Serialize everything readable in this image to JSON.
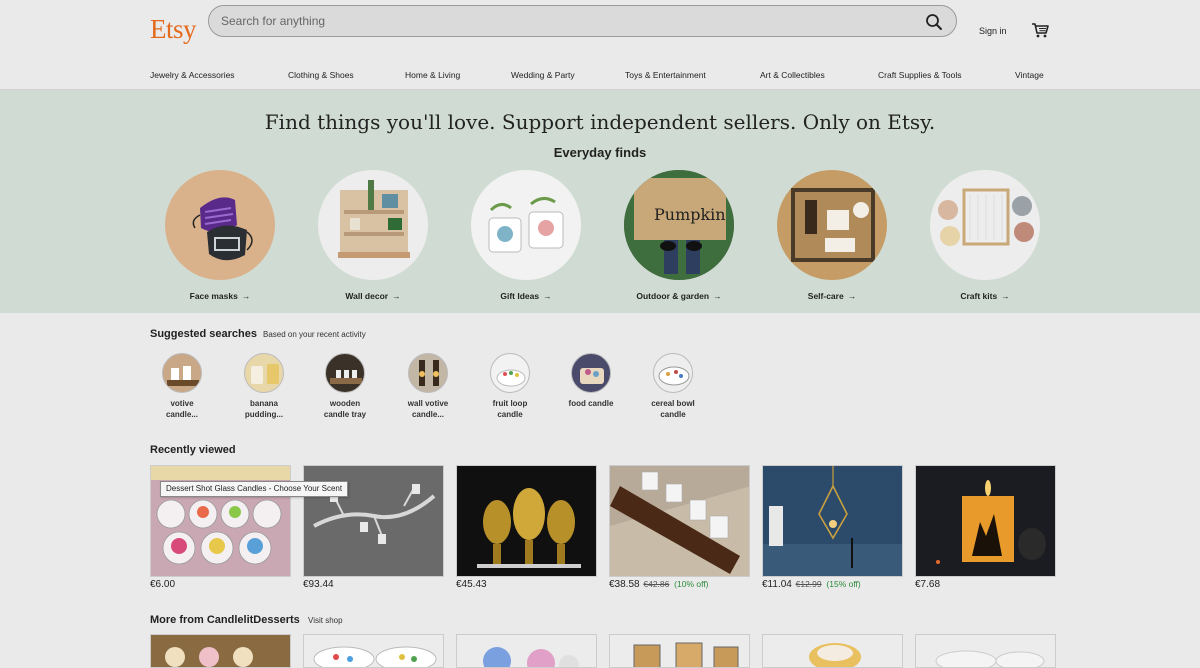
{
  "header": {
    "logo": "Etsy",
    "search_placeholder": "Search for anything",
    "sign_in": "Sign in"
  },
  "nav": [
    "Jewelry & Accessories",
    "Clothing & Shoes",
    "Home & Living",
    "Wedding & Party",
    "Toys & Entertainment",
    "Art & Collectibles",
    "Craft Supplies & Tools",
    "Vintage"
  ],
  "hero": {
    "title": "Find things you'll love. Support independent sellers. Only on Etsy.",
    "subtitle": "Everyday finds",
    "arrow": "→",
    "categories": [
      "Face masks",
      "Wall decor",
      "Gift Ideas",
      "Outdoor & garden",
      "Self-care",
      "Craft kits"
    ]
  },
  "suggested": {
    "title": "Suggested searches",
    "note": "Based on your recent activity",
    "items": [
      [
        "votive",
        "candle..."
      ],
      [
        "banana",
        "pudding..."
      ],
      [
        "wooden",
        "candle tray"
      ],
      [
        "wall votive",
        "candle..."
      ],
      [
        "fruit loop",
        "candle"
      ],
      [
        "food candle",
        ""
      ],
      [
        "cereal bowl",
        "candle"
      ]
    ]
  },
  "recent": {
    "title": "Recently viewed",
    "tooltip": "Dessert Shot Glass Candles - Choose Your Scent",
    "items": [
      {
        "price": "€6.00",
        "old": "",
        "disc": ""
      },
      {
        "price": "€93.44",
        "old": "",
        "disc": ""
      },
      {
        "price": "€45.43",
        "old": "",
        "disc": ""
      },
      {
        "price": "€38.58",
        "old": "€42.86",
        "disc": "(10% off)"
      },
      {
        "price": "€11.04",
        "old": "€12.99",
        "disc": "(15% off)"
      },
      {
        "price": "€7.68",
        "old": "",
        "disc": ""
      }
    ]
  },
  "more": {
    "title": "More from CandlelitDesserts",
    "visit": "Visit shop"
  },
  "colors": {
    "brand": "#e36a1e",
    "hero_bg": "#d0dcd3",
    "discount": "#2a8a3a"
  }
}
